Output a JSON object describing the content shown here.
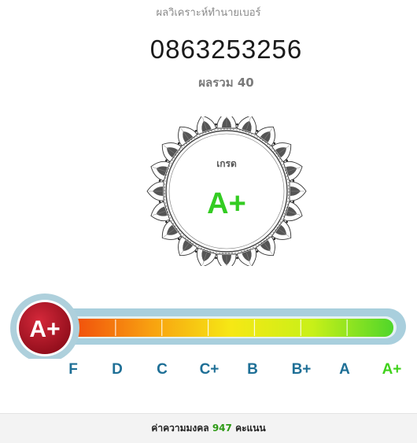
{
  "header": {
    "title": "ผลวิเคราะห์ทำนายเบอร์"
  },
  "phone_number": "0863253256",
  "total": {
    "label": "ผลรวม",
    "value": "40"
  },
  "grade": {
    "label": "เกรด",
    "value": "A+",
    "badge": "A+",
    "color": "#33cc22"
  },
  "scale": {
    "letters": [
      "F",
      "D",
      "C",
      "C+",
      "B",
      "B+",
      "A",
      "A+"
    ],
    "active_index": 7,
    "level_fraction": 1.0,
    "colors": {
      "inactive": "#1e6f96",
      "active": "#3fd21b"
    }
  },
  "footer": {
    "prefix": "ค่าความมงคล",
    "score": "947",
    "suffix": "คะแนน"
  }
}
